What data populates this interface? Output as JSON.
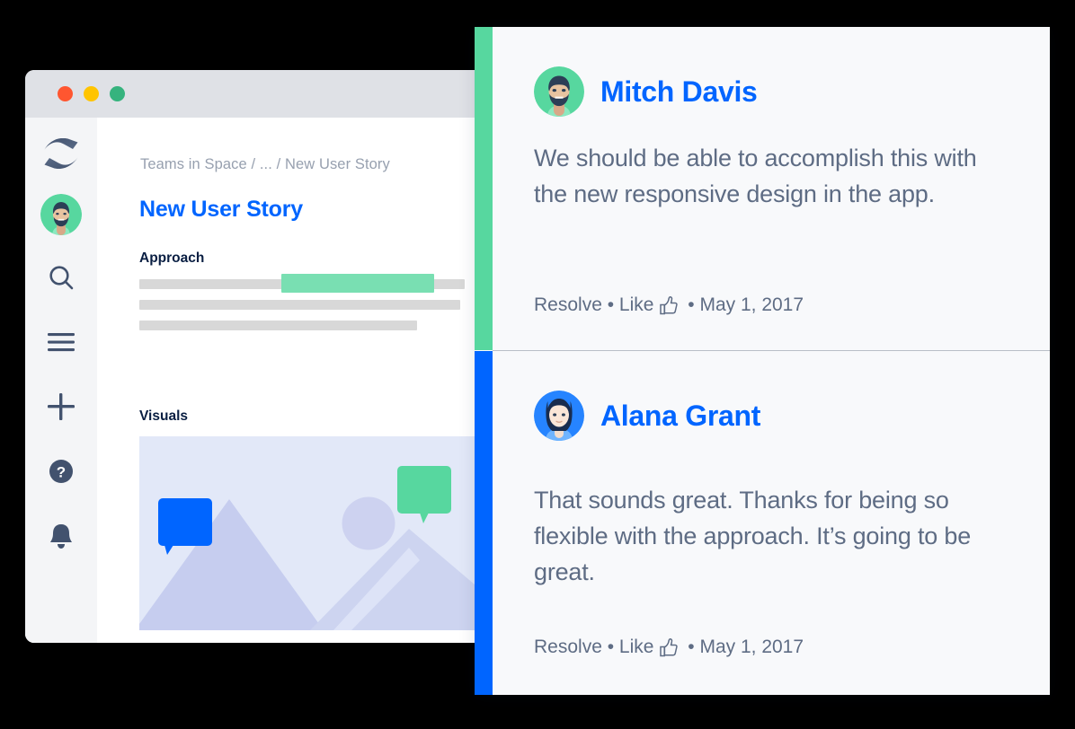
{
  "window": {
    "traffic_lights": [
      {
        "name": "close",
        "color": "#ff5630"
      },
      {
        "name": "minimize",
        "color": "#ffc400"
      },
      {
        "name": "zoom",
        "color": "#36b37e"
      }
    ]
  },
  "sidebar": {
    "items": [
      {
        "name": "confluence-logo",
        "icon": "confluence-logo-icon",
        "label": "Confluence"
      },
      {
        "name": "profile",
        "icon": "avatar-icon",
        "label": "Profile"
      },
      {
        "name": "search",
        "icon": "search-icon",
        "label": "Search"
      },
      {
        "name": "menu",
        "icon": "hamburger-menu-icon",
        "label": "Menu"
      },
      {
        "name": "create",
        "icon": "plus-icon",
        "label": "Create"
      },
      {
        "name": "help",
        "icon": "help-question-icon",
        "label": "Help"
      },
      {
        "name": "notifications",
        "icon": "bell-icon",
        "label": "Notifications"
      }
    ]
  },
  "content": {
    "breadcrumb": "Teams in Space / ... / New User Story",
    "title": "New User Story",
    "sections": [
      {
        "heading": "Approach"
      },
      {
        "heading": "Visuals"
      }
    ]
  },
  "comments": [
    {
      "author": "Mitch Davis",
      "avatar": "mitch-avatar",
      "accent_color": "#57d79f",
      "body": "We should be able to accomplish this with the new responsive design in the app.",
      "meta": {
        "resolve": "Resolve",
        "sep1": " • ",
        "like": "Like",
        "like_icon": "thumbs-up-icon",
        "sep2": " • ",
        "date": "May 1, 2017"
      }
    },
    {
      "author": "Alana Grant",
      "avatar": "alana-avatar",
      "accent_color": "#0065ff",
      "body": "That sounds great. Thanks for being so flexible with the approach. It’s going to be great.",
      "meta": {
        "resolve": "Resolve",
        "sep1": " • ",
        "like": "Like",
        "like_icon": "thumbs-up-icon",
        "sep2": " • ",
        "date": "May 1, 2017"
      }
    }
  ],
  "colors": {
    "accent_blue": "#0065ff",
    "accent_green": "#57d79f",
    "highlight_green": "#79dfb2",
    "text_muted": "#5e6c84",
    "text_breadcrumb": "#97a0af",
    "titlebar": "#dfe1e6",
    "rail_bg": "#f4f5f7",
    "panel_bg": "#f8f9fb",
    "skeleton": "#d8d8d8",
    "illustration_bg": "#e2e8f8",
    "illustration_mountain": "#c6cdef",
    "illustration_mountain_light": "#cdd4f0"
  }
}
